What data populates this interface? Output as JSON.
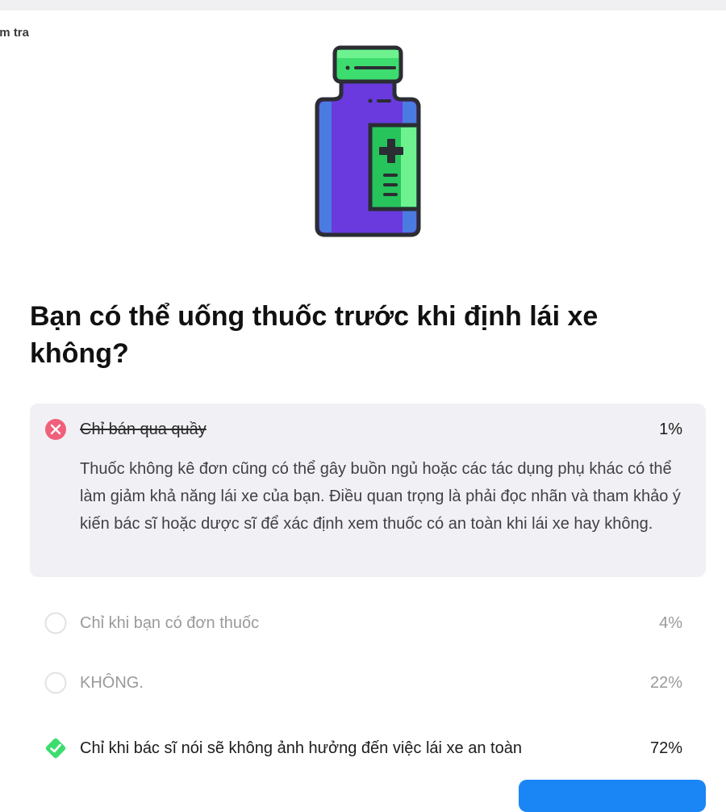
{
  "breadcrumb": "Kiểm tra",
  "illustration_icon": "medicine-bottle-icon",
  "question": "Bạn có thể uống thuốc trước khi định lái xe không?",
  "answers": [
    {
      "label": "Chỉ bán qua quầy",
      "percent": "1%",
      "state": "incorrect-selected",
      "explanation": "Thuốc không kê đơn cũng có thể gây buồn ngủ hoặc các tác dụng phụ khác có thể làm giảm khả năng lái xe của bạn. Điều quan trọng là phải đọc nhãn và tham khảo ý kiến bác sĩ hoặc dược sĩ để xác định xem thuốc có an toàn khi lái xe hay không."
    },
    {
      "label": "Chỉ khi bạn có đơn thuốc",
      "percent": "4%",
      "state": "unselected"
    },
    {
      "label": "KHÔNG.",
      "percent": "22%",
      "state": "unselected"
    },
    {
      "label": "Chỉ khi bác sĩ nói sẽ không ảnh hưởng đến việc lái xe an toàn",
      "percent": "72%",
      "state": "correct"
    }
  ],
  "colors": {
    "incorrect": "#f0607a",
    "correct": "#3ddc6e",
    "accent": "#1a86f5",
    "expanded_bg": "#f1f1f5"
  }
}
